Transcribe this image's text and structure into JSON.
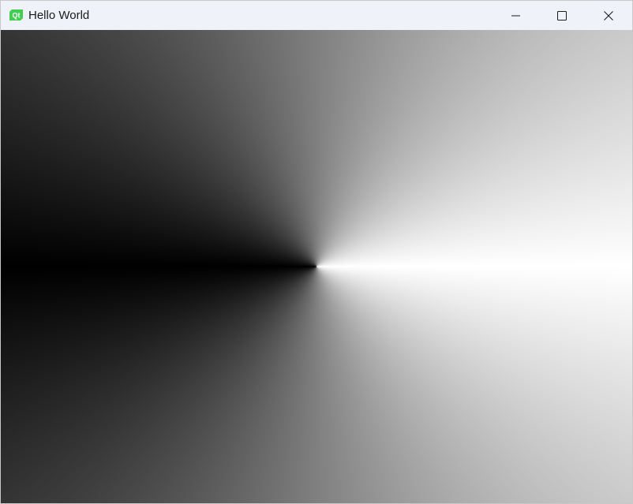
{
  "window": {
    "title": "Hello World",
    "app_icon": "qt-logo-icon",
    "accent_color": "#41cd52"
  },
  "controls": {
    "minimize_icon": "minimize-icon",
    "maximize_icon": "maximize-icon",
    "close_icon": "close-icon"
  },
  "canvas": {
    "fill": "conical-gradient",
    "gradient_colors": [
      "#000000",
      "#ffffff"
    ]
  }
}
